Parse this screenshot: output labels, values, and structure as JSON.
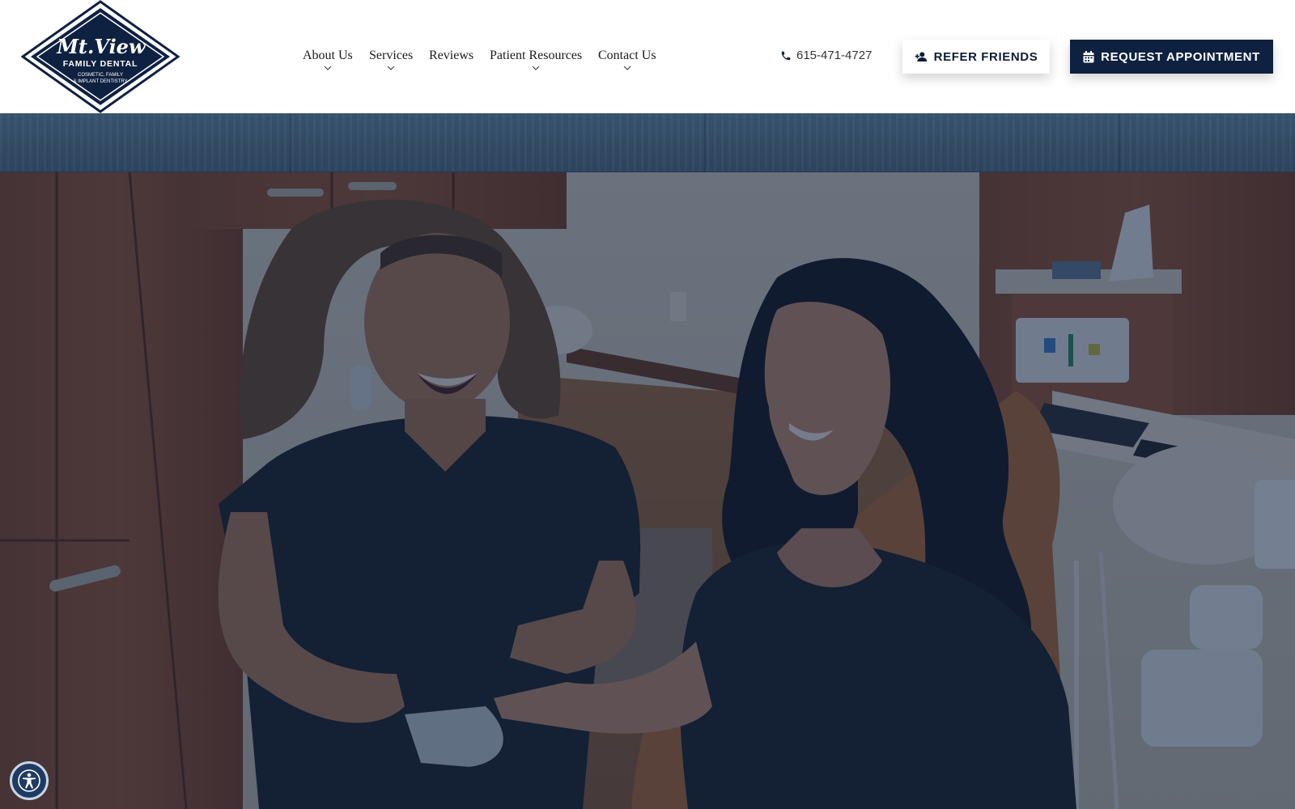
{
  "brand": {
    "script_name": "Mt.View",
    "name": "FAMILY DENTAL",
    "tagline_1": "COSMETIC, FAMILY",
    "tagline_2": "& IMPLANT DENTISTRY",
    "navy": "#0f2140"
  },
  "nav": {
    "items": [
      {
        "label": "About Us",
        "has_dropdown": true
      },
      {
        "label": "Services",
        "has_dropdown": true
      },
      {
        "label": "Reviews",
        "has_dropdown": false
      },
      {
        "label": "Patient Resources",
        "has_dropdown": true
      },
      {
        "label": "Contact Us",
        "has_dropdown": true
      }
    ]
  },
  "header": {
    "phone": "615-471-4727",
    "phone_icon": "phone-icon",
    "refer_label": "REFER FRIENDS",
    "refer_icon": "user-plus-icon",
    "appointment_label": "REQUEST APPOINTMENT",
    "appointment_icon": "calendar-icon"
  },
  "hero": {
    "image": "two-women-laughing-in-dental-office",
    "overlay_color": "#0f2140"
  },
  "accessibility": {
    "icon": "accessibility-icon"
  }
}
